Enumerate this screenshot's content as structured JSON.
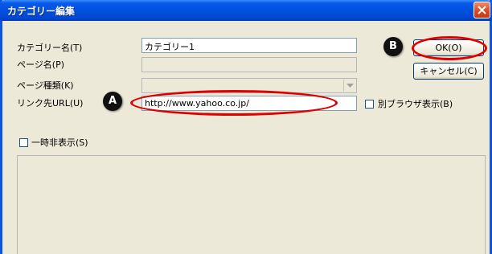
{
  "window": {
    "title": "カテゴリー編集",
    "close_glyph": "×"
  },
  "form": {
    "category_name_label": "カテゴリー名(T)",
    "category_name_value": "カテゴリー1",
    "page_name_label": "ページ名(P)",
    "page_name_value": "",
    "page_type_label": "ページ種類(K)",
    "page_type_value": "",
    "link_url_label": "リンク先URL(U)",
    "link_url_value": "http://www.yahoo.co.jp/",
    "separate_browser_label": "別ブラウザ表示(B)",
    "separate_browser_checked": false,
    "temporarily_hide_label": "一時非表示(S)",
    "temporarily_hide_checked": false
  },
  "buttons": {
    "ok_label": "OK(O)",
    "cancel_label": "キャンセル(C)"
  },
  "annotations": {
    "a_badge": "A",
    "b_badge": "B",
    "highlight_color": "#e00000"
  },
  "colors": {
    "titlebar": "#0054e3",
    "dialog_bg": "#ece9d8",
    "field_border": "#7f9db9"
  }
}
